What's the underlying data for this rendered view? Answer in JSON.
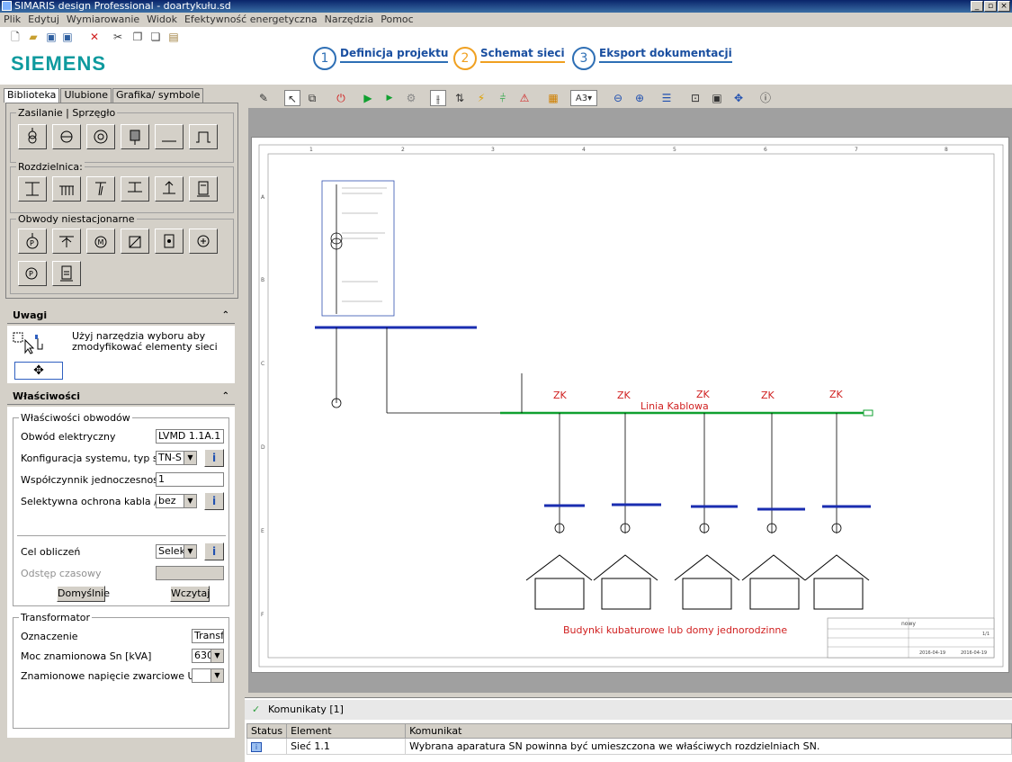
{
  "window": {
    "title": "SIMARIS design Professional - doartykułu.sd"
  },
  "menu": [
    "Plik",
    "Edytuj",
    "Wymiarowanie",
    "Widok",
    "Efektywność energetyczna",
    "Narzędzia",
    "Pomoc"
  ],
  "brand": {
    "logo": "SIEMENS",
    "color": "#0e9a9e"
  },
  "steps": [
    {
      "num": "1",
      "label": "Definicja projektu"
    },
    {
      "num": "2",
      "label": "Schemat sieci"
    },
    {
      "num": "3",
      "label": "Eksport dokumentacji"
    }
  ],
  "library": {
    "tabs": [
      "Biblioteka",
      "Ulubione",
      "Grafika/ symbole"
    ],
    "groups": {
      "supply": "Zasilanie  | Sprzęgło",
      "distribution": "Rozdzielnica:",
      "circuits": "Obwody niestacjonarne"
    }
  },
  "notes": {
    "title": "Uwagi",
    "text": "Użyj narzędzia wyboru aby zmodyfikować elementy sieci"
  },
  "properties": {
    "title": "Właściwości",
    "circuit_group": "Właściwości obwodów",
    "fields": {
      "circuit_label": "Obwód elektryczny",
      "circuit_value": "LVMD 1.1A.1",
      "system_label": "Konfiguracja systemu, typ sieci",
      "system_value": "TN-S",
      "simultaneity_label": "Współczynnik jednoczesności",
      "simultaneity_value": "1",
      "selective_label": "Selektywna ochrona kabla / szy",
      "selective_value": "bez",
      "calc_label": "Cel obliczeń",
      "calc_value": "Selekty",
      "time_label": "Odstęp czasowy"
    },
    "buttons": {
      "default": "Domyślnie",
      "load": "Wczytaj"
    },
    "transformer_group": "Transformator",
    "transformer": {
      "name_label": "Oznaczenie",
      "name_value": "Transfo",
      "power_label": "Moc znamionowa Sn [kVA]",
      "power_value": "630",
      "ukr_label": "Znamionowe napięcie zwarciowe Ukr [%]"
    }
  },
  "diagram": {
    "grid_cols": [
      "1",
      "2",
      "3",
      "4",
      "5",
      "6",
      "7",
      "8"
    ],
    "grid_rows": [
      "A",
      "B",
      "C",
      "D",
      "E",
      "F"
    ],
    "zk_label": "ZK",
    "cable_line": "Linia Kablowa",
    "buildings": "Budynki kubaturowe lub domy jednorodzinne",
    "title_block": {
      "title": "nowy",
      "sheet": "1/1",
      "date1": "2016-04-19",
      "date2": "2016-04-19"
    }
  },
  "messages": {
    "title": "Komunikaty [1]",
    "columns": [
      "Status",
      "Element",
      "Komunikat"
    ],
    "rows": [
      {
        "element": "Sieć 1.1",
        "message": "Wybrana aparatura SN powinna być umieszczona we właściwych rozdzielniach SN."
      }
    ]
  }
}
